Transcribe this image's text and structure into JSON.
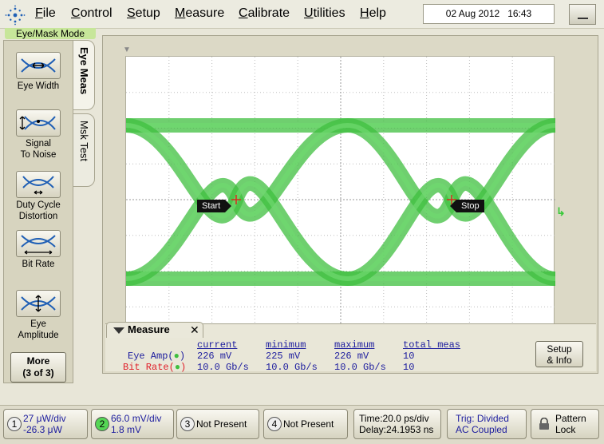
{
  "menu": {
    "items": [
      {
        "label": "File",
        "ul": "F",
        "rest": "ile"
      },
      {
        "label": "Control",
        "ul": "C",
        "rest": "ontrol"
      },
      {
        "label": "Setup",
        "ul": "S",
        "rest": "etup"
      },
      {
        "label": "Measure",
        "ul": "M",
        "rest": "easure"
      },
      {
        "label": "Calibrate",
        "ul": "C",
        "rest": "alibrate"
      },
      {
        "label": "Utilities",
        "ul": "U",
        "rest": "tilities"
      },
      {
        "label": "Help",
        "ul": "H",
        "rest": "elp"
      }
    ],
    "date": "02 Aug 2012",
    "time": "16:43"
  },
  "mode_label": "Eye/Mask Mode",
  "tabs": {
    "eye_meas": "Eye Meas",
    "msk_test": "Msk Test"
  },
  "tools": [
    {
      "line1": "Eye Width",
      "line2": "",
      "icon": "eye-width-icon"
    },
    {
      "line1": "Signal",
      "line2": "To Noise",
      "icon": "signal-to-noise-icon"
    },
    {
      "line1": "Duty Cycle",
      "line2": "Distortion",
      "icon": "duty-cycle-icon"
    },
    {
      "line1": "Bit Rate",
      "line2": "",
      "icon": "bit-rate-icon"
    },
    {
      "line1": "Eye",
      "line2": "Amplitude",
      "icon": "eye-amplitude-icon"
    }
  ],
  "more": {
    "line1": "More",
    "line2": "(3 of 3)"
  },
  "markers": {
    "start": "Start",
    "stop": "Stop"
  },
  "measure": {
    "title": "Measure",
    "close": "✕",
    "headers": {
      "current": "current",
      "minimum": "minimum",
      "maximum": "maximum",
      "total": "total meas"
    },
    "rows": [
      {
        "name": "Eye Amp(",
        "close_paren": ")",
        "current": "226 mV",
        "minimum": "225 mV",
        "maximum": "226 mV",
        "total": "10",
        "color": "#1c1c9e",
        "dot": "#55d655"
      },
      {
        "name": "Bit Rate(",
        "close_paren": ")",
        "current": "10.0 Gb/s",
        "minimum": "10.0 Gb/s",
        "maximum": "10.0 Gb/s",
        "total": "10",
        "color": "#e0202a",
        "dot": "#55d655"
      }
    ],
    "setup_info": {
      "line1": "Setup",
      "line2": "& Info"
    }
  },
  "channels": [
    {
      "num": "1",
      "line1": "27 μW/div",
      "line2": "-26.3 μW"
    },
    {
      "num": "2",
      "line1": "66.0 mV/div",
      "line2": "1.8 mV"
    },
    {
      "num": "3",
      "label": "Not Present"
    },
    {
      "num": "4",
      "label": "Not Present"
    }
  ],
  "timebase": {
    "line1": "Time:20.0 ps/div",
    "line2": "Delay:24.1953 ns"
  },
  "trigger": {
    "line1": "Trig: Divided",
    "line2": "AC Coupled"
  },
  "pattern_lock": {
    "line1": "Pattern",
    "line2": "Lock"
  },
  "colors": {
    "trace": "#3fbf3f",
    "accent_blue": "#1c1c9e",
    "accent_red": "#e0202a"
  }
}
